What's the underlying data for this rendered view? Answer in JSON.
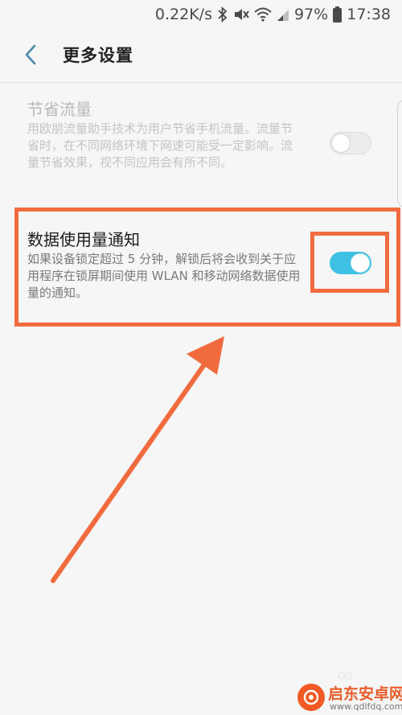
{
  "status_bar": {
    "network_speed": "0.22K/s",
    "battery": "97%",
    "time": "17:38"
  },
  "header": {
    "title": "更多设置"
  },
  "settings": [
    {
      "title": "节省流量",
      "description": "用欧朋流量助手技术为用户节省手机流量。流量节省时，在不同网络环境下网速可能受一定影响。流量节省效果，视不同应用会有所不同。",
      "enabled": false,
      "toggle_state": "off"
    },
    {
      "title": "数据使用量通知",
      "description": "如果设备锁定超过 5 分钟，解锁后将会收到关于应用程序在锁屏期间使用 WLAN 和移动网络数据使用量的通知。",
      "enabled": true,
      "toggle_state": "on"
    }
  ],
  "colors": {
    "accent_toggle": "#3ec0e4",
    "annotation": "#f26b3f",
    "back_arrow": "#4a8aa8"
  },
  "watermark": {
    "brand": "启东安卓网",
    "url": "www.qdlfdq.com"
  }
}
